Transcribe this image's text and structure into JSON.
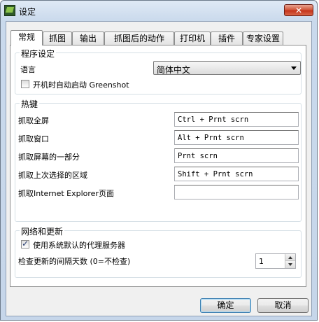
{
  "window": {
    "title": "设定",
    "close_label": "✕"
  },
  "tabs": [
    {
      "label": "常规",
      "active": true
    },
    {
      "label": "抓图"
    },
    {
      "label": "输出"
    },
    {
      "label": "抓图后的动作"
    },
    {
      "label": "打印机"
    },
    {
      "label": "插件"
    },
    {
      "label": "专家设置"
    }
  ],
  "program_settings": {
    "legend": "程序设定",
    "language_label": "语言",
    "language_value": "简体中文",
    "autostart_label": "开机时自动启动 Greenshot",
    "autostart_checked": false
  },
  "hotkeys": {
    "legend": "热键",
    "items": [
      {
        "label": "抓取全屏",
        "value": "Ctrl + Prnt scrn"
      },
      {
        "label": "抓取窗口",
        "value": "Alt + Prnt scrn"
      },
      {
        "label": "抓取屏幕的一部分",
        "value": "Prnt scrn"
      },
      {
        "label": "抓取上次选择的区域",
        "value": "Shift + Prnt scrn"
      },
      {
        "label": "抓取Internet Explorer页面",
        "value": ""
      }
    ]
  },
  "network": {
    "legend": "网络和更新",
    "proxy_label": "使用系统默认的代理服务器",
    "proxy_checked": true,
    "update_label": "检查更新的间隔天数 (0=不检查)",
    "update_value": "1"
  },
  "buttons": {
    "ok": "确定",
    "cancel": "取消"
  },
  "colors": {
    "accent": "#3c7fb1",
    "close": "#c4351d"
  }
}
